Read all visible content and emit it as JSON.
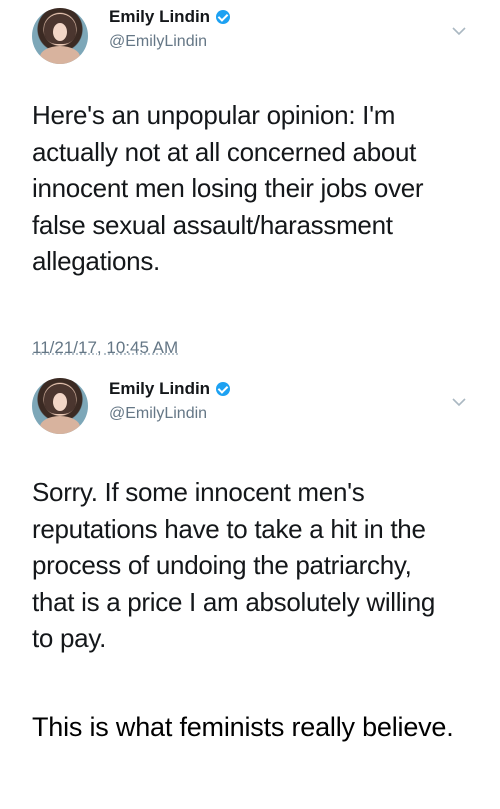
{
  "tweets": [
    {
      "author_name": "Emily Lindin",
      "handle": "@EmilyLindin",
      "text": "Here's an unpopular opinion: I'm\nactually not at all concerned about\ninnocent men losing their jobs over\nfalse sexual assault/harassment\nallegations.",
      "timestamp": "11/21/17, 10:45 AM",
      "verified": true
    },
    {
      "author_name": "Emily Lindin",
      "handle": "@EmilyLindin",
      "text": "Sorry. If some innocent men's\nreputations have to take a hit in the\nprocess of undoing the patriarchy,\nthat is a price I am absolutely willing\nto pay.",
      "verified": true
    }
  ],
  "caption": "This is what feminists really believe.",
  "colors": {
    "verified_badge": "#1da1f2",
    "secondary_text": "#657786",
    "primary_text": "#14171a"
  }
}
